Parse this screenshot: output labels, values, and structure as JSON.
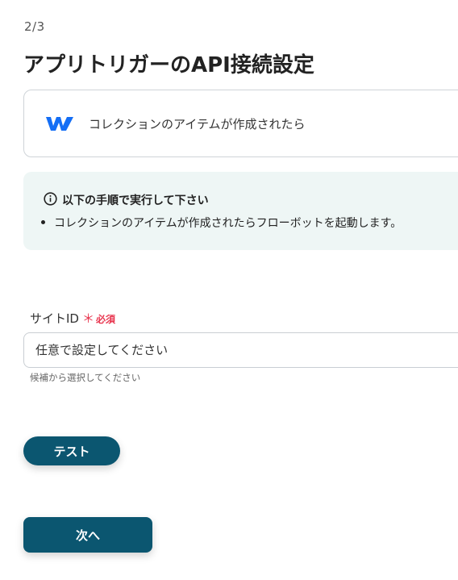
{
  "header": {
    "step": "2/3",
    "title": "アプリトリガーのAPI接続設定"
  },
  "app_card": {
    "logo_icon": "webflow-logo-icon",
    "brand_color": "#146EF5",
    "trigger_text": "コレクションのアイテムが作成されたら"
  },
  "info": {
    "icon": "info-circle-icon",
    "title": "以下の手順で実行して下さい",
    "items": [
      "コレクションのアイテムが作成されたらフローボットを起動します。"
    ]
  },
  "site_id_field": {
    "label": "サイトID",
    "required_mark": "＊",
    "required_text": "必須",
    "placeholder": "任意で設定してください",
    "hint": "候補から選択してください"
  },
  "buttons": {
    "test_label": "テスト",
    "next_label": "次へ"
  },
  "colors": {
    "primary_button": "#0B5670",
    "info_background": "#EEF6F5",
    "required": "#E8354E"
  }
}
